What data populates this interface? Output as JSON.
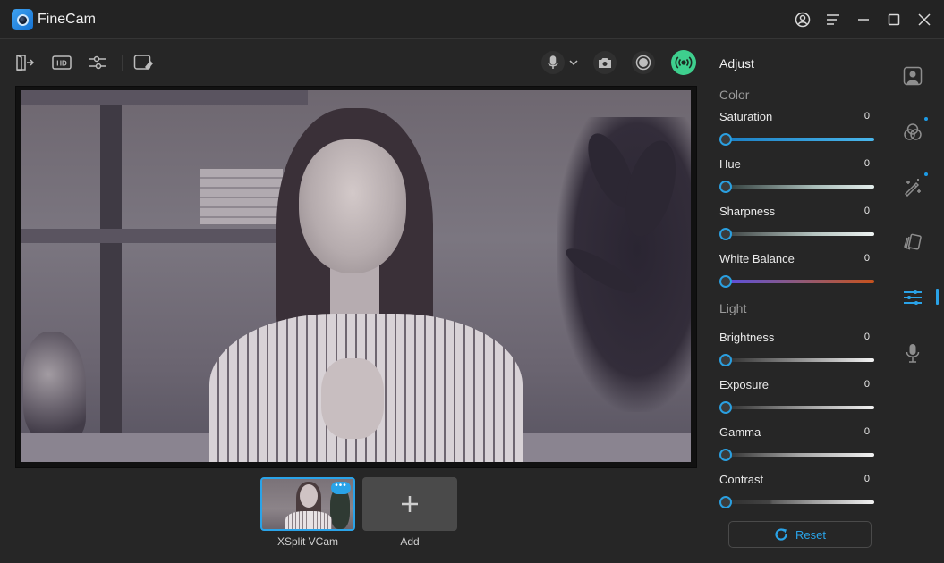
{
  "app": {
    "title": "FineCam",
    "window_controls": [
      "account-icon",
      "menu-icon",
      "minimize-icon",
      "maximize-icon",
      "close-icon"
    ]
  },
  "toolbar": {
    "left_icons": [
      "exit-icon",
      "hd-icon",
      "settings-sliders-icon",
      "whiteboard-icon"
    ],
    "hd_label": "HD",
    "right_icons": [
      "microphone-icon",
      "chevron-down-icon",
      "camera-icon",
      "record-icon",
      "live-broadcast-icon"
    ],
    "accent_live": "#3ecf8e"
  },
  "sources": {
    "items": [
      {
        "label": "XSplit VCam",
        "selected": true,
        "more_label": "•••"
      },
      {
        "label": "Add",
        "add_symbol": "+"
      }
    ]
  },
  "adjust": {
    "title": "Adjust",
    "groups": [
      {
        "label": "Color",
        "sliders": [
          {
            "label": "Saturation",
            "value": "0",
            "track": "saturation"
          },
          {
            "label": "Hue",
            "value": "0",
            "track": "hue"
          },
          {
            "label": "Sharpness",
            "value": "0",
            "track": "sharpness"
          },
          {
            "label": "White Balance",
            "value": "0",
            "track": "white-balance"
          }
        ]
      },
      {
        "label": "Light",
        "sliders": [
          {
            "label": "Brightness",
            "value": "0",
            "track": "brightness"
          },
          {
            "label": "Exposure",
            "value": "0",
            "track": "exposure"
          },
          {
            "label": "Gamma",
            "value": "0",
            "track": "gamma"
          },
          {
            "label": "Contrast",
            "value": "0",
            "track": "contrast"
          }
        ]
      }
    ],
    "reset_label": "Reset",
    "accent": "#2aa3e8"
  },
  "rail": {
    "items": [
      {
        "icon": "portrait-icon",
        "badge": false
      },
      {
        "icon": "color-filter-icon",
        "badge": true
      },
      {
        "icon": "magic-wand-icon",
        "badge": true
      },
      {
        "icon": "cards-icon",
        "badge": false
      },
      {
        "icon": "adjust-sliders-icon",
        "active": true
      },
      {
        "icon": "microphone-icon",
        "badge": false
      }
    ]
  }
}
